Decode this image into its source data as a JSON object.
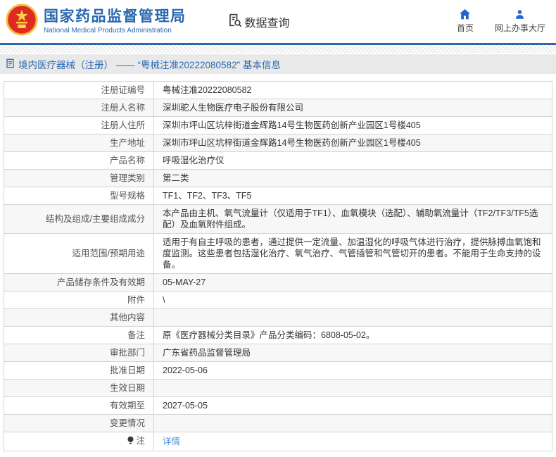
{
  "header": {
    "agency_name_zh": "国家药品监督管理局",
    "agency_name_en": "National Medical Products Administration",
    "data_query_label": "数据查询",
    "home_label": "首页",
    "online_hall_label": "网上办事大厅"
  },
  "title_bar": {
    "text": "境内医疗器械（注册） —— “粤械注准20222080582” 基本信息"
  },
  "table": {
    "rows": [
      {
        "label": "注册证编号",
        "value": "粤械注准20222080582"
      },
      {
        "label": "注册人名称",
        "value": "深圳驼人生物医疗电子股份有限公司"
      },
      {
        "label": "注册人住所",
        "value": "深圳市坪山区坑梓街道金辉路14号生物医药创新产业园区1号楼405"
      },
      {
        "label": "生产地址",
        "value": "深圳市坪山区坑梓街道金辉路14号生物医药创新产业园区1号楼405"
      },
      {
        "label": "产品名称",
        "value": "呼吸湿化治疗仪"
      },
      {
        "label": "管理类别",
        "value": "第二类"
      },
      {
        "label": "型号规格",
        "value": "TF1、TF2、TF3、TF5"
      },
      {
        "label": "结构及组成/主要组成成分",
        "value": "本产品由主机、氧气流量计（仅适用于TF1）、血氧模块（选配）、辅助氧流量计（TF2/TF3/TF5选配）及血氧附件组成。"
      },
      {
        "label": "适用范围/预期用途",
        "value": "适用于有自主呼吸的患者，通过提供一定流量、加温湿化的呼吸气体进行治疗，提供脉搏血氧饱和度监测。这些患者包括湿化治疗、氧气治疗、气管插管和气管切开的患者。不能用于生命支持的设备。"
      },
      {
        "label": "产品储存条件及有效期",
        "value": "05-MAY-27"
      },
      {
        "label": "附件",
        "value": "\\"
      },
      {
        "label": "其他内容",
        "value": ""
      },
      {
        "label": "备注",
        "value": "原《医疗器械分类目录》产品分类编码：6808-05-02。"
      },
      {
        "label": "审批部门",
        "value": "广东省药品监督管理局"
      },
      {
        "label": "批准日期",
        "value": "2022-05-06"
      },
      {
        "label": "生效日期",
        "value": ""
      },
      {
        "label": "有效期至",
        "value": "2027-05-05"
      },
      {
        "label": "变更情况",
        "value": ""
      },
      {
        "label": "注",
        "value": "详情",
        "link": true,
        "icon": "bulb-icon"
      }
    ]
  },
  "colors": {
    "brand_blue": "#2a68b0",
    "link_blue": "#4a90d9",
    "emblem_red": "#de2a22",
    "emblem_gold": "#f3c545",
    "row_alt_bg": "#f7f7f7",
    "title_bar_bg": "#e9e9e9"
  }
}
